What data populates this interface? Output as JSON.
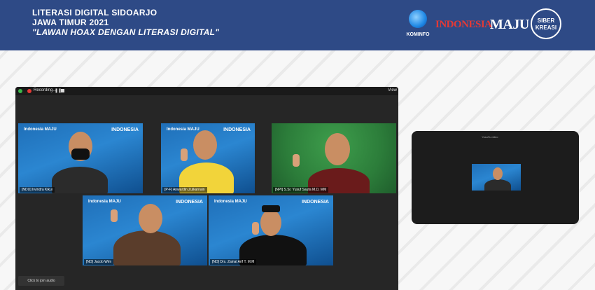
{
  "banner": {
    "line1": "LITERASI DIGITAL SIDOARJO",
    "line2": "JAWA TIMUR 2021",
    "line3": "\"LAWAN HOAX DENGAN LITERASI DIGITAL\"",
    "logo_kominfo": "KOMINFO",
    "logo_indonesia": "INDONESIA",
    "logo_maju": "MAJU",
    "logo_siber": "SIBER KREASI"
  },
  "zoom": {
    "recording_label": "Recording...",
    "view_label": "View",
    "join_audio": "Click to join audio",
    "tile_logo": "Indonesia MAJU",
    "tile_tag": "INDONESIA",
    "participants": [
      {
        "name": "[NDU] Irvindra Kikui"
      },
      {
        "name": "[P-F] Anwardin Zulkarnain"
      },
      {
        "name": "[NPI] S.Sr. Yusuf Saufa M.D, MM"
      },
      {
        "name": "[ND] Jacob Wim"
      },
      {
        "name": "[ND] Drs. Zainal Arif T. M.M"
      }
    ],
    "mini_title": "Yusuf's video"
  },
  "colors": {
    "banner_bg": "#2e4a86",
    "tile_blue": "#1f6fb8",
    "tile_green": "#2c7d3a",
    "accent_red": "#e53935"
  }
}
